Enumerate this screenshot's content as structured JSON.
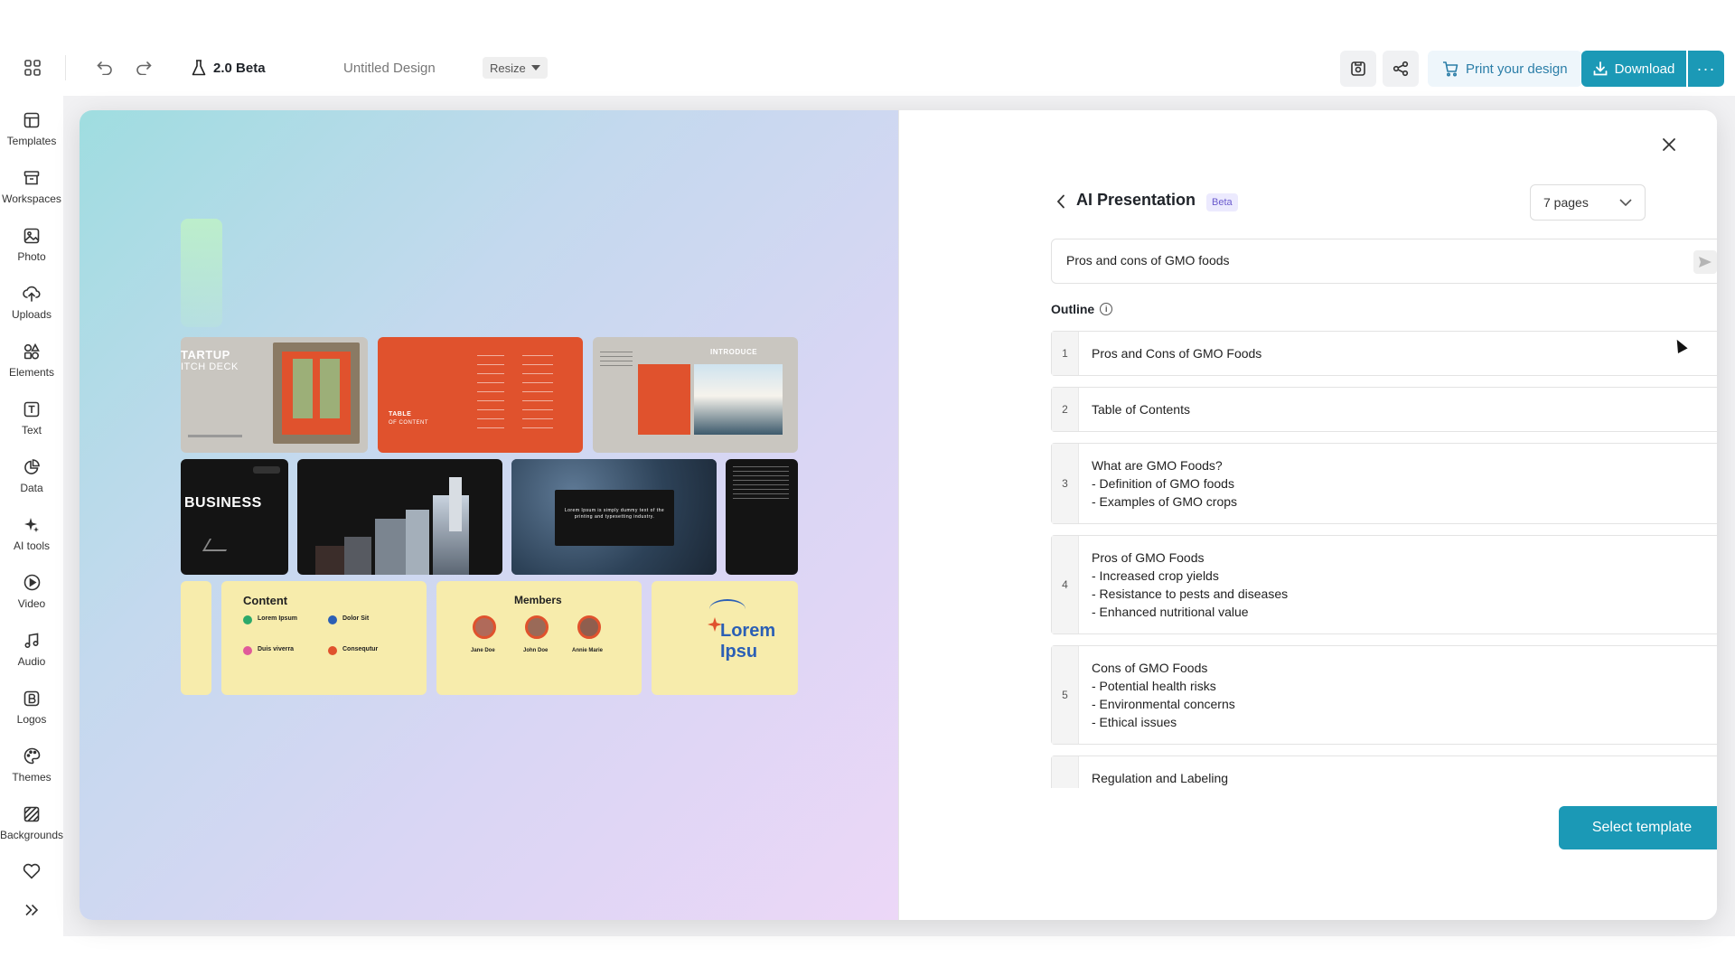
{
  "header": {
    "apps_icon": "apps-grid-icon",
    "version": "2.0 Beta",
    "document_title": "Untitled Design",
    "resize_label": "Resize",
    "print_label": "Print your design",
    "download_label": "Download"
  },
  "sidebar": {
    "items": [
      {
        "label": "Templates",
        "icon": "templates-icon"
      },
      {
        "label": "Workspaces",
        "icon": "workspaces-icon"
      },
      {
        "label": "Photo",
        "icon": "photo-icon"
      },
      {
        "label": "Uploads",
        "icon": "upload-cloud-icon"
      },
      {
        "label": "Elements",
        "icon": "elements-icon"
      },
      {
        "label": "Text",
        "icon": "text-icon"
      },
      {
        "label": "Data",
        "icon": "data-chart-icon"
      },
      {
        "label": "AI tools",
        "icon": "ai-sparkle-icon"
      },
      {
        "label": "Video",
        "icon": "video-play-icon"
      },
      {
        "label": "Audio",
        "icon": "audio-note-icon"
      },
      {
        "label": "Logos",
        "icon": "logos-icon"
      },
      {
        "label": "Themes",
        "icon": "themes-palette-icon"
      },
      {
        "label": "Backgrounds",
        "icon": "backgrounds-icon"
      }
    ]
  },
  "preview": {
    "thumbs": {
      "startup": "TARTUP",
      "startup_sub": "ITCH DECK",
      "table": "TABLE",
      "table_sub": "OF CONTENT",
      "introduce": "INTRODUCE",
      "business": "BUSINESS",
      "lorem_text": "Lorem Ipsum is simply dummy text of the printing and typesetting industry.",
      "content_title": "Content",
      "content_items": [
        "Lorem Ipsum",
        "Dolor Sit",
        "Duis viverra",
        "Consequtur"
      ],
      "members_title": "Members",
      "members": [
        "Jane Doe",
        "John Doe",
        "Annie Marie"
      ],
      "lorem_big": "Lorem Ipsu"
    }
  },
  "panel": {
    "title": "AI Presentation",
    "badge": "Beta",
    "pages_select": "7 pages",
    "prompt_value": "Pros and cons of GMO foods",
    "outline_label": "Outline",
    "outline": [
      {
        "num": "1",
        "lines": [
          "Pros and Cons of GMO Foods"
        ]
      },
      {
        "num": "2",
        "lines": [
          "Table of Contents"
        ]
      },
      {
        "num": "3",
        "lines": [
          "What are GMO Foods?",
          "- Definition of GMO foods",
          "- Examples of GMO crops"
        ]
      },
      {
        "num": "4",
        "lines": [
          "Pros of GMO Foods",
          "- Increased crop yields",
          "- Resistance to pests and diseases",
          "- Enhanced nutritional value"
        ]
      },
      {
        "num": "5",
        "lines": [
          "Cons of GMO Foods",
          "- Potential health risks",
          "- Environmental concerns",
          "- Ethical issues"
        ]
      },
      {
        "num": "",
        "lines": [
          "Regulation and Labeling"
        ]
      }
    ],
    "select_template_label": "Select template"
  }
}
